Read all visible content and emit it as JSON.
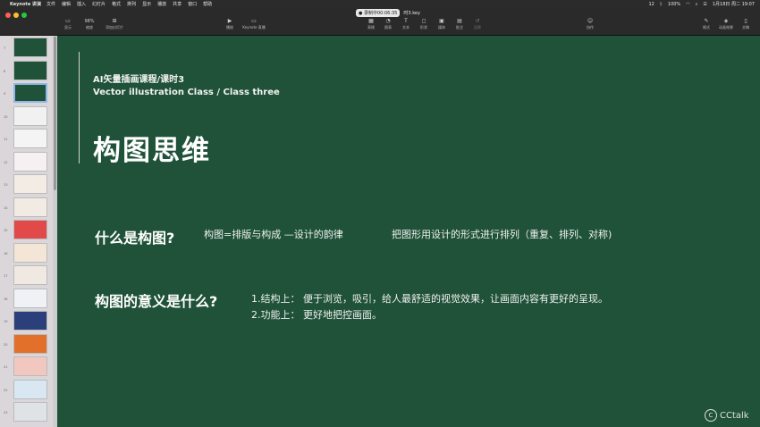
{
  "menubar": {
    "app_name": "Keynote 讲演",
    "items": [
      "文件",
      "编辑",
      "插入",
      "幻灯片",
      "格式",
      "排列",
      "显示",
      "播放",
      "共享",
      "窗口",
      "帮助"
    ],
    "battery": "100%",
    "datetime": "1月18日 周二 19:07",
    "calendar_badge": "12"
  },
  "toolbar": {
    "buttons": [
      {
        "label": "显示",
        "icon": "view-icon"
      },
      {
        "label": "缩放",
        "value": "98%",
        "icon": "zoom-icon"
      },
      {
        "label": "添加幻灯片",
        "icon": "add-slide-icon"
      },
      {
        "label": "播放",
        "icon": "play-icon"
      },
      {
        "label": "Keynote 直播",
        "icon": "live-icon"
      },
      {
        "label": "表格",
        "icon": "table-icon"
      },
      {
        "label": "图表",
        "icon": "chart-icon"
      },
      {
        "label": "文本",
        "icon": "text-icon"
      },
      {
        "label": "形状",
        "icon": "shape-icon"
      },
      {
        "label": "媒体",
        "icon": "media-icon"
      },
      {
        "label": "批注",
        "icon": "comment-icon"
      },
      {
        "label": "还原",
        "icon": "revert-icon"
      },
      {
        "label": "协作",
        "icon": "collaborate-icon"
      },
      {
        "label": "格式",
        "icon": "format-icon"
      },
      {
        "label": "动画效果",
        "icon": "animate-icon"
      },
      {
        "label": "文稿",
        "icon": "document-icon"
      }
    ],
    "recording": "● 录制中00:06:35",
    "file_name": "时3.key"
  },
  "navigator": {
    "slides": [
      {
        "num": "7",
        "bg": "#1f5238"
      },
      {
        "num": "8",
        "bg": "#1f5238"
      },
      {
        "num": "9",
        "bg": "#1f5238",
        "selected": true
      },
      {
        "num": "10",
        "bg": "#f1f1f1"
      },
      {
        "num": "11",
        "bg": "#f4f4f4"
      },
      {
        "num": "12",
        "bg": "#f6f0f2"
      },
      {
        "num": "13",
        "bg": "#f3ece4"
      },
      {
        "num": "14",
        "bg": "#f1ebe3"
      },
      {
        "num": "15",
        "bg": "#e24a4a"
      },
      {
        "num": "16",
        "bg": "#f3e6d6"
      },
      {
        "num": "17",
        "bg": "#f0e9e2"
      },
      {
        "num": "18",
        "bg": "#eef2f6"
      },
      {
        "num": "19",
        "bg": "#2b3f7a"
      },
      {
        "num": "20",
        "bg": "#e2702a"
      },
      {
        "num": "21",
        "bg": "#f2c7bf"
      },
      {
        "num": "22",
        "bg": "#d8e7f1"
      },
      {
        "num": "23",
        "bg": "#dfe3e6"
      }
    ]
  },
  "slide": {
    "course_cn": "AI矢量插画课程/课时3",
    "course_en": "Vector illustration Class / Class three",
    "title": "构图思维",
    "question1": "什么是构图?",
    "q1_definition": "构图=排版与构成 —设计的韵律",
    "q1_description": "把图形用设计的形式进行排列（重复、排列、对称)",
    "question2": "构图的意义是什么?",
    "point1": "1.结构上： 便于浏览，吸引，给人最舒适的视觉效果，让画面内容有更好的呈现。",
    "point2": "2.功能上： 更好地把控画面。",
    "watermark": "CCtalk",
    "background_color": "#1f5238"
  }
}
